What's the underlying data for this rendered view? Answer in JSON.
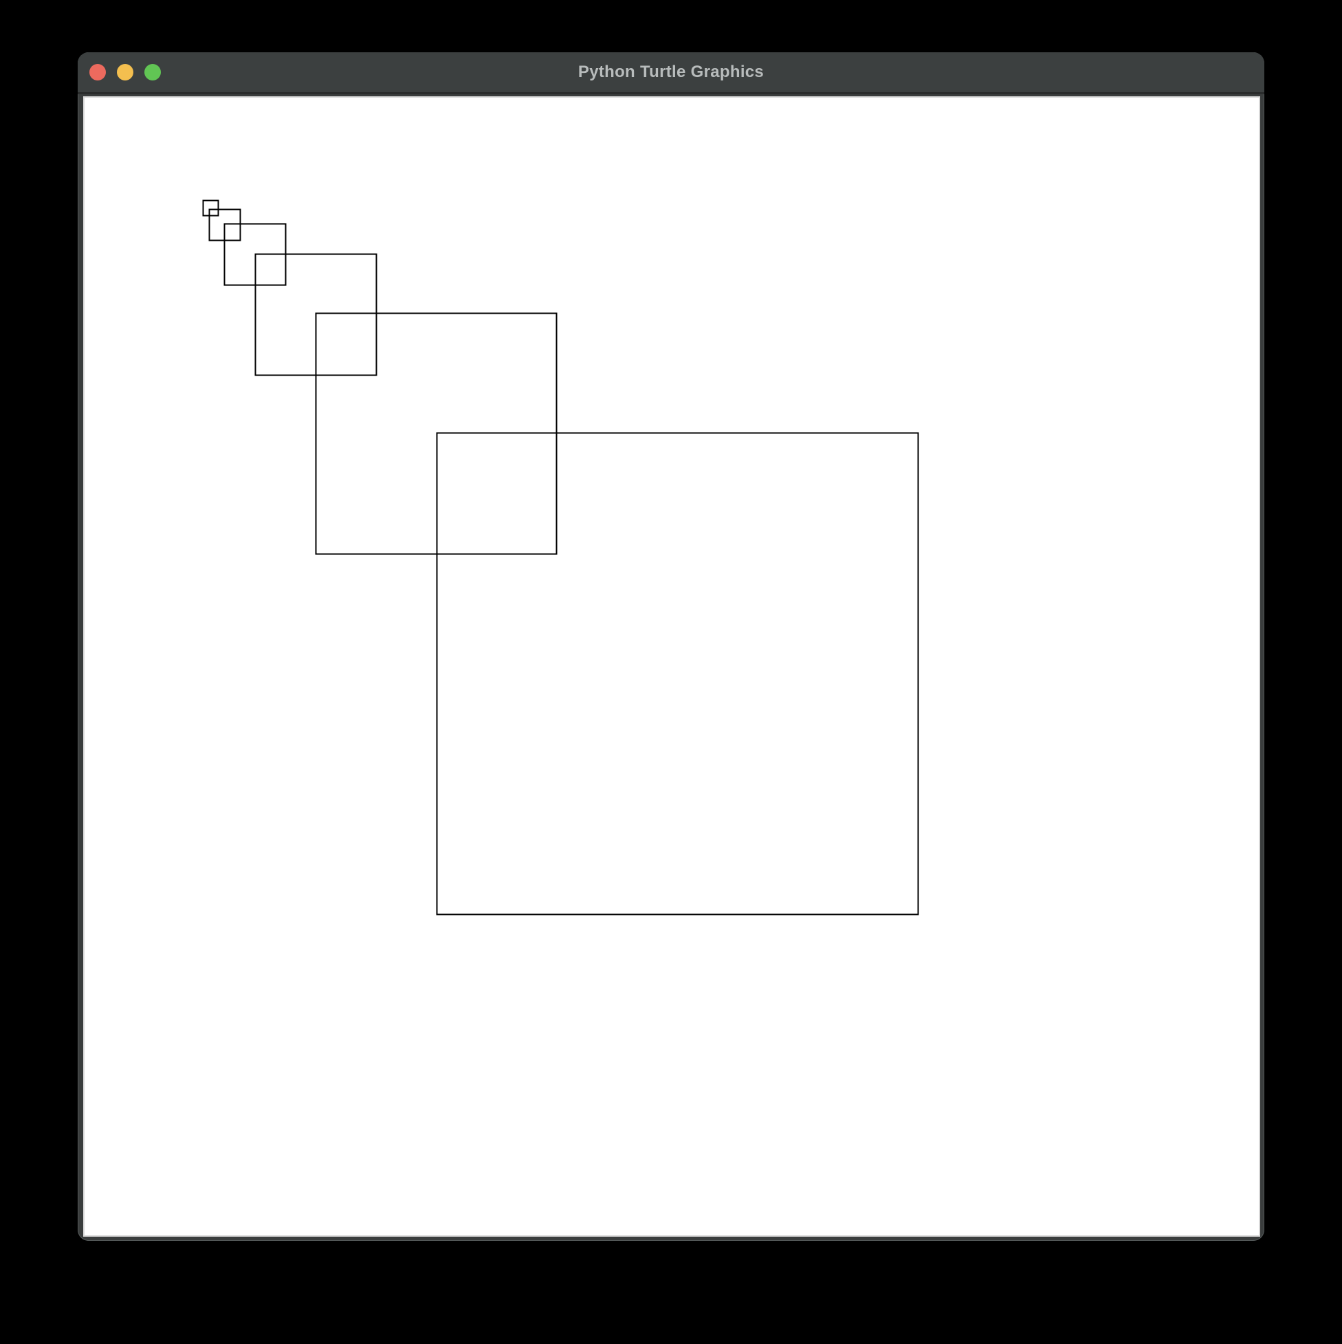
{
  "window": {
    "title": "Python Turtle Graphics",
    "controls": {
      "close_color": "#ec6a5e",
      "minimize_color": "#f4bf4f",
      "maximize_color": "#61c554"
    }
  },
  "canvas": {
    "background": "#ffffff",
    "pen_color": "#000000",
    "shapes": [
      {
        "type": "square",
        "name": "square-1"
      },
      {
        "type": "square",
        "name": "square-2"
      },
      {
        "type": "square",
        "name": "square-3"
      },
      {
        "type": "square",
        "name": "square-4"
      },
      {
        "type": "square",
        "name": "square-5"
      },
      {
        "type": "square",
        "name": "square-6"
      }
    ]
  }
}
